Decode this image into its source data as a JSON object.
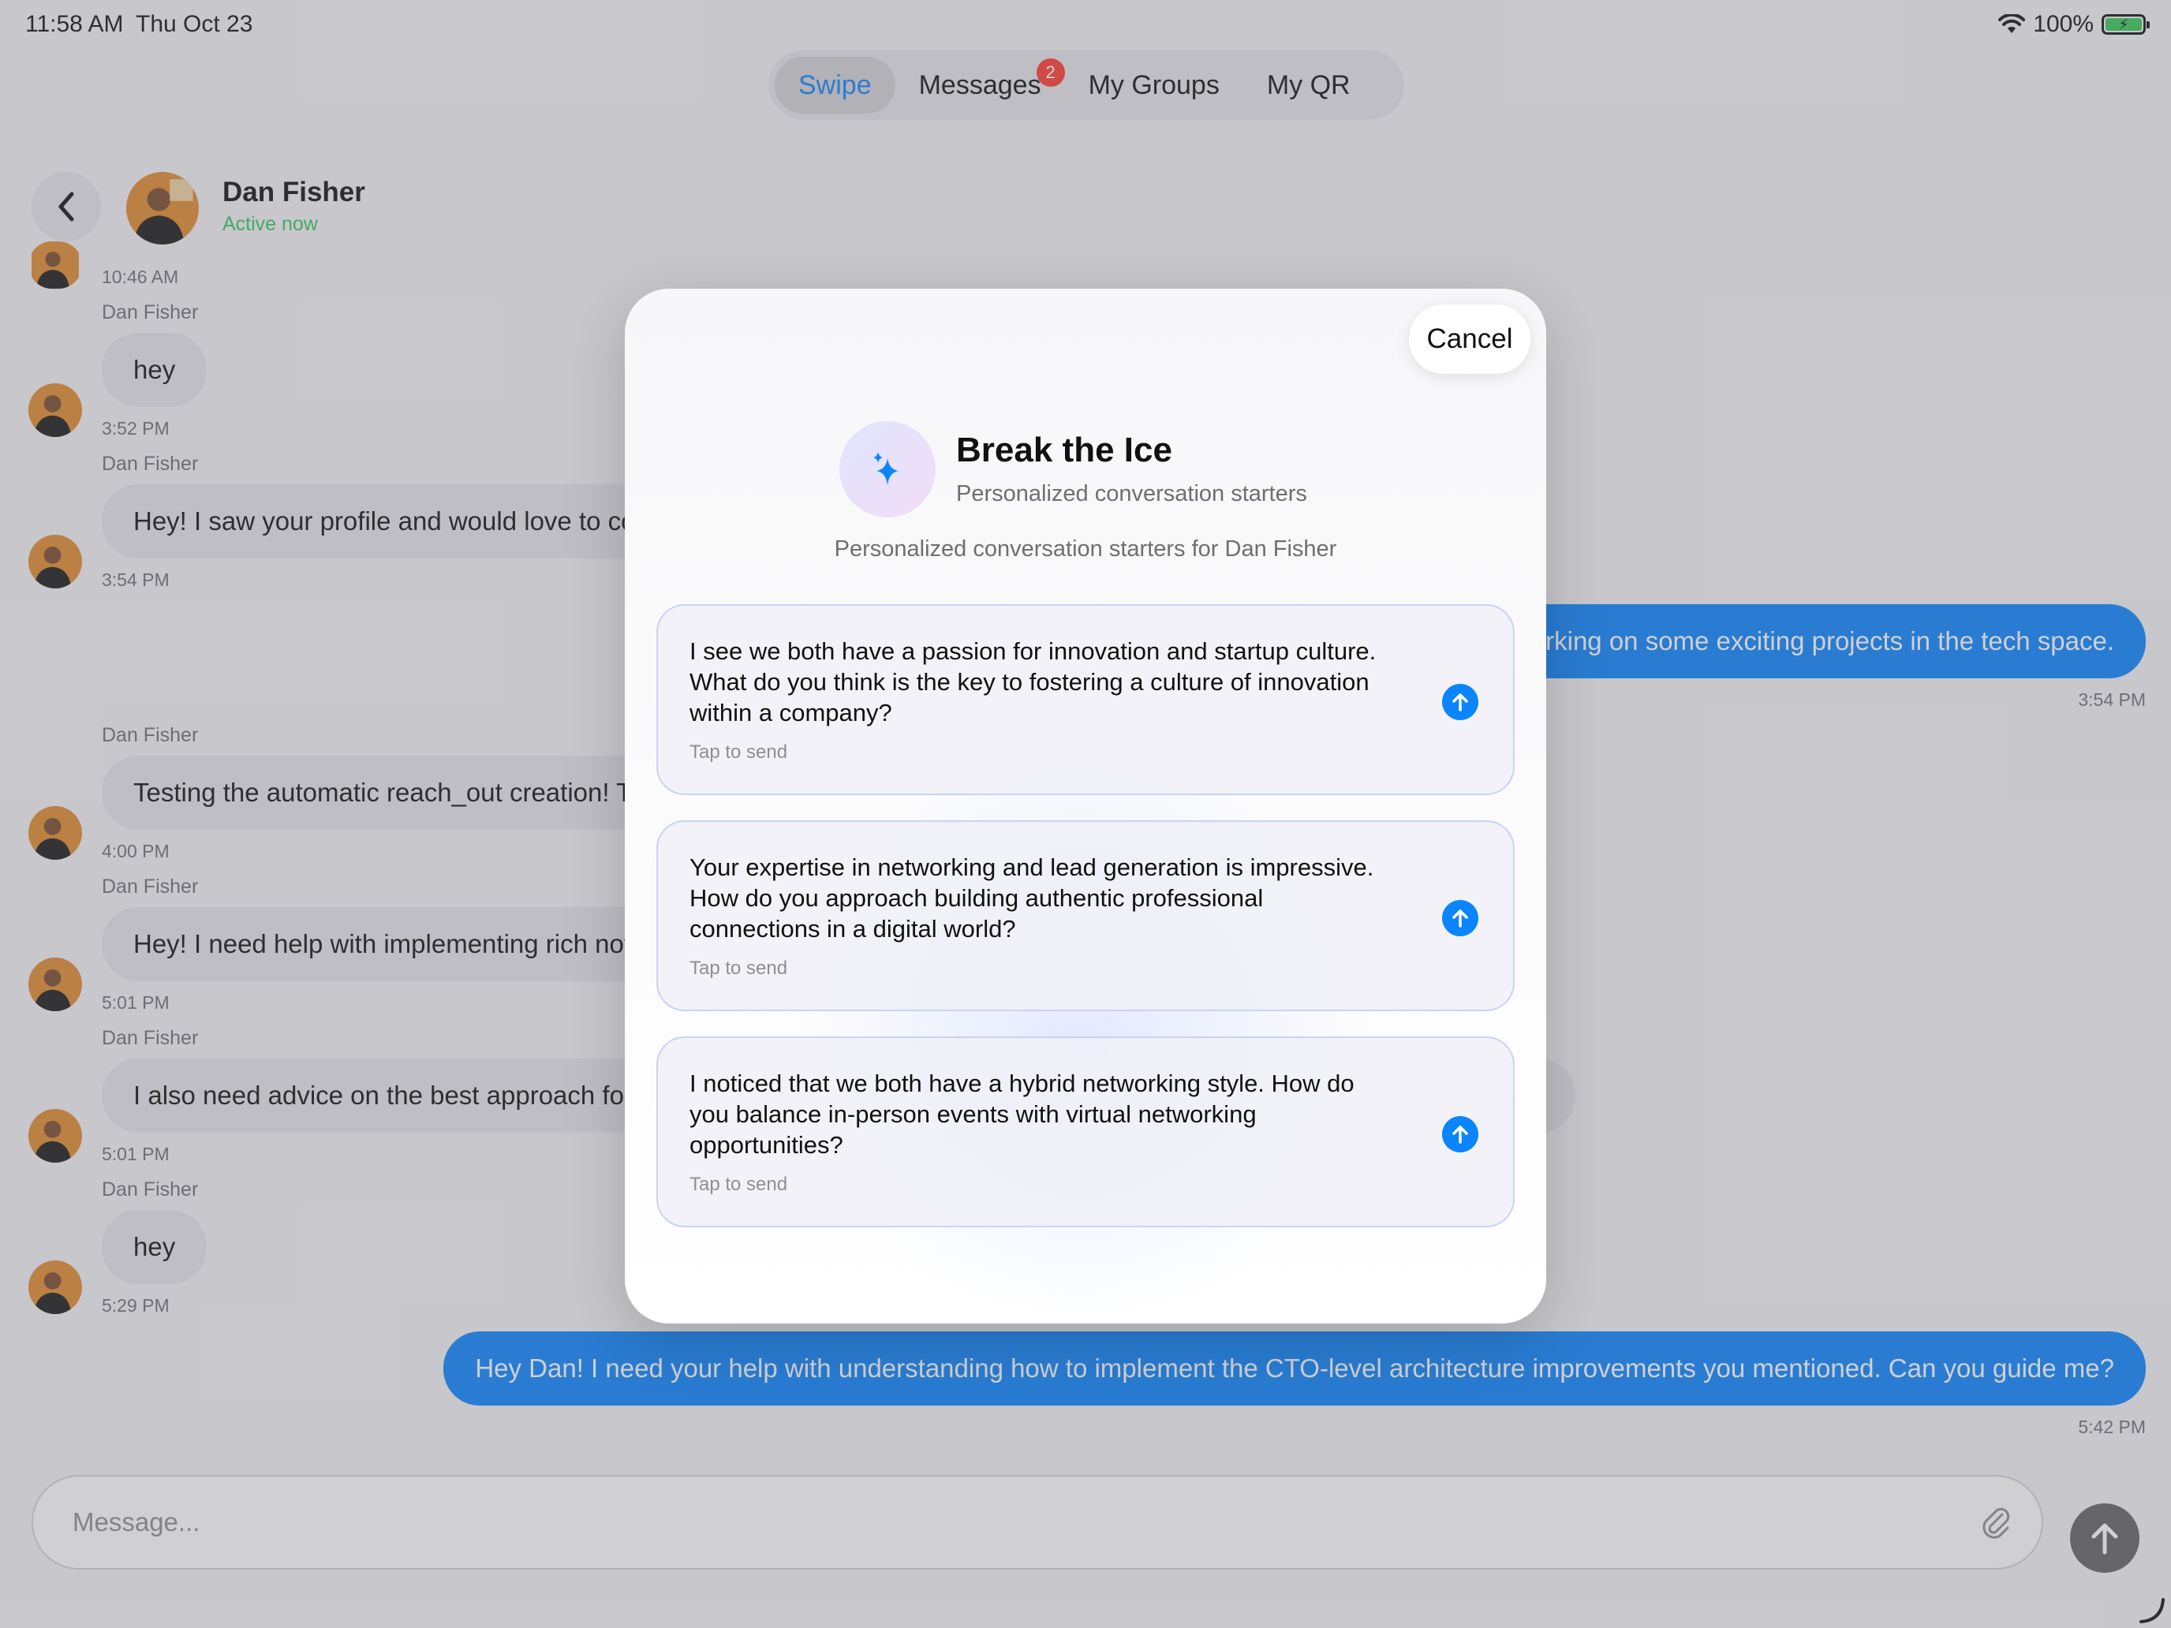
{
  "status_bar": {
    "time": "11:58 AM",
    "date": "Thu Oct 23",
    "battery": "100%"
  },
  "tabs": [
    {
      "label": "Swipe",
      "active": true
    },
    {
      "label": "Messages",
      "badge": "2"
    },
    {
      "label": "My Groups"
    },
    {
      "label": "My QR"
    }
  ],
  "chat_header": {
    "name": "Dan Fisher",
    "status": "Active now"
  },
  "messages": [
    {
      "time": "10:46 AM"
    },
    {
      "sender": "Dan Fisher",
      "text": "hey",
      "time": "3:52 PM"
    },
    {
      "sender": "Dan Fisher",
      "text": "Hey! I saw your profile and would love to connect!",
      "time": "3:54 PM"
    },
    {
      "outgoing": true,
      "text": "Thanks! I'm currently working on some exciting projects in the tech space.",
      "time": "3:54 PM"
    },
    {
      "sender": "Dan Fisher",
      "text": "Testing the automatic reach_out creation! This should work now.",
      "time": "4:00 PM"
    },
    {
      "sender": "Dan Fisher",
      "text": "Hey! I need help with implementing rich notifications for my app.",
      "time": "5:01 PM"
    },
    {
      "sender": "Dan Fisher",
      "text": "I also need advice on the best approach for scaling the backend infrastructure.",
      "time": "5:01 PM"
    },
    {
      "sender": "Dan Fisher",
      "text": "hey",
      "time": "5:29 PM"
    },
    {
      "outgoing": true,
      "text": "Hey Dan! I need your help with understanding how to implement the CTO-level architecture improvements you mentioned. Can you guide me?",
      "time": "5:42 PM"
    }
  ],
  "composer": {
    "placeholder": "Message..."
  },
  "modal": {
    "cancel_label": "Cancel",
    "title": "Break the Ice",
    "subtitle": "Personalized conversation starters",
    "description": "Personalized conversation starters for Dan Fisher",
    "starters": [
      {
        "text": "I see we both have a passion for innovation and startup culture. What do you think is the key to fostering a culture of innovation within a company?",
        "hint": "Tap to send"
      },
      {
        "text": "Your expertise in networking and lead generation is impressive. How do you approach building authentic professional connections in a digital world?",
        "hint": "Tap to send"
      },
      {
        "text": "I noticed that we both have a hybrid networking style. How do you balance in-person events with virtual networking opportunities?",
        "hint": "Tap to send"
      }
    ]
  },
  "colors": {
    "accent": "#0a84ff",
    "online": "#34c759",
    "badge": "#ff3b30"
  },
  "icons": [
    "wifi-icon",
    "battery-icon",
    "back-chevron-icon",
    "avatar-icon",
    "paperclip-icon",
    "send-arrow-icon",
    "sparkle-icon",
    "arrow-up-icon"
  ]
}
